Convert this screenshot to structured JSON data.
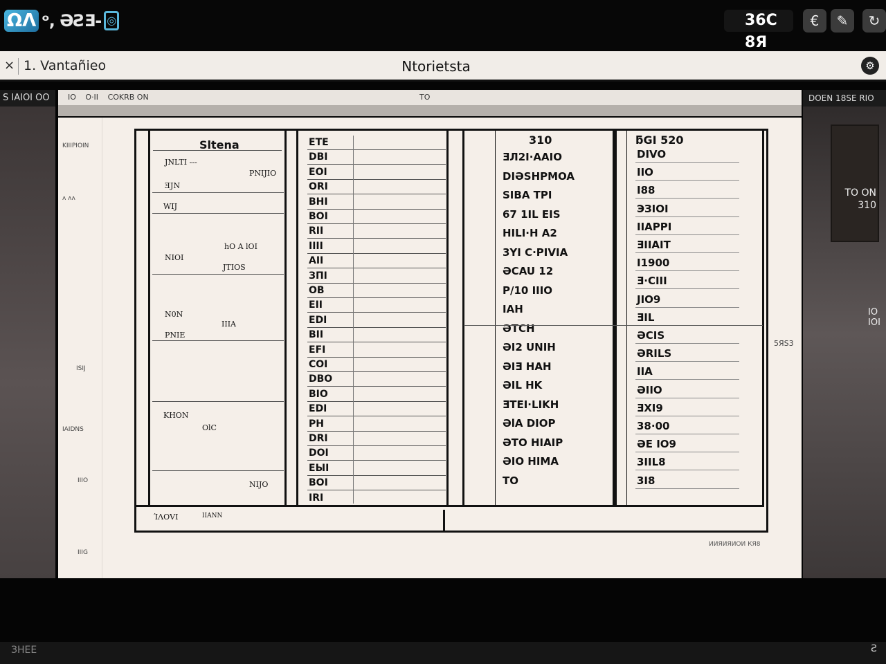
{
  "topbar": {
    "logo_mark": "ΩΛ",
    "logo_text": "",
    "temperature": "36C 8Я",
    "buttons": [
      "€",
      "✎",
      "↻"
    ]
  },
  "docbar": {
    "close_label": "×",
    "doc_name": "1. Vantañieo",
    "title": "Ntorietsta"
  },
  "left": {
    "header": "S IAIOI OO",
    "notes": [
      "KIIIPIOIN",
      "ᴧ ᴧᴧ",
      "ISIJ",
      "IAIDNS",
      "IIIO",
      "IIIG"
    ]
  },
  "right": {
    "header": "DOEN 18SE RIO",
    "shelf": "TO ON 310",
    "side": "IO IOI",
    "mid_label": "5ЯS3"
  },
  "paper": {
    "toolbar": [
      "IO",
      "O·II",
      "COKRB ON"
    ],
    "toolbar_right": "TO"
  },
  "table": {
    "col1": {
      "title": "Sltena",
      "notes": [
        "JNLTI ---",
        "PNIJIO",
        "ƎJN",
        "WIJ",
        "hO A lOI",
        "NIOI",
        "JTIOS",
        "N0N",
        "IIIA",
        "PNIE",
        "KHON",
        "OlC",
        "NIJO"
      ]
    },
    "col2_rows": [
      "ETE",
      "DBI",
      "EOI",
      "ORI",
      "BHI",
      "BOI",
      "RII",
      "IIII",
      "AII",
      "ЗПІ",
      "OB",
      "EII",
      "EDI",
      "BII",
      "EFI",
      "COI",
      "DBO",
      "BIO",
      "EDI",
      "PH",
      "DRI",
      "DOI",
      "ЕЫІ",
      "BOI",
      "IRI"
    ],
    "col3": {
      "title": "310",
      "rows": [
        "ƎЛ2I·AAIO",
        "DIƏSHPMOA",
        "SIBA TPI",
        "67 1IL EIS",
        "HILI·H A2",
        "3YI C·PIVIA",
        "ƏCAU 12",
        "P/10 IIIO",
        "IAH",
        "ƏTCH",
        "ƏI2 UNIH",
        "ƏIƎ HAH",
        "ƏIL HK",
        "ƎTEI·LIKH",
        "ƏlA DIOP",
        "ƏTO HIAIP",
        "ƏIO HIMA",
        "TO"
      ]
    },
    "col4": {
      "title": "ƃGI 520",
      "rows": [
        "DIVO",
        "IIO",
        "I88",
        "ЭЗIOI",
        "IIAPPI",
        "ƎIIAIT",
        "I1900",
        "Ǝ·CIII",
        "JIO9",
        "ƎIL",
        "ƏCIS",
        "ƏRILS",
        "IIA",
        "ƏIIO",
        "ƎXI9",
        "38·00",
        "ƏE IO9",
        "3IIL8",
        "3I8"
      ]
    }
  },
  "bottom_strip": {
    "left": "ΊΛΟVI",
    "mid": "IIANN"
  },
  "footnote": "ИИЯИЯИОИ КЯ8",
  "bottom_bar": {
    "left": "ЗНЕЕ",
    "right": "Ƨ"
  }
}
